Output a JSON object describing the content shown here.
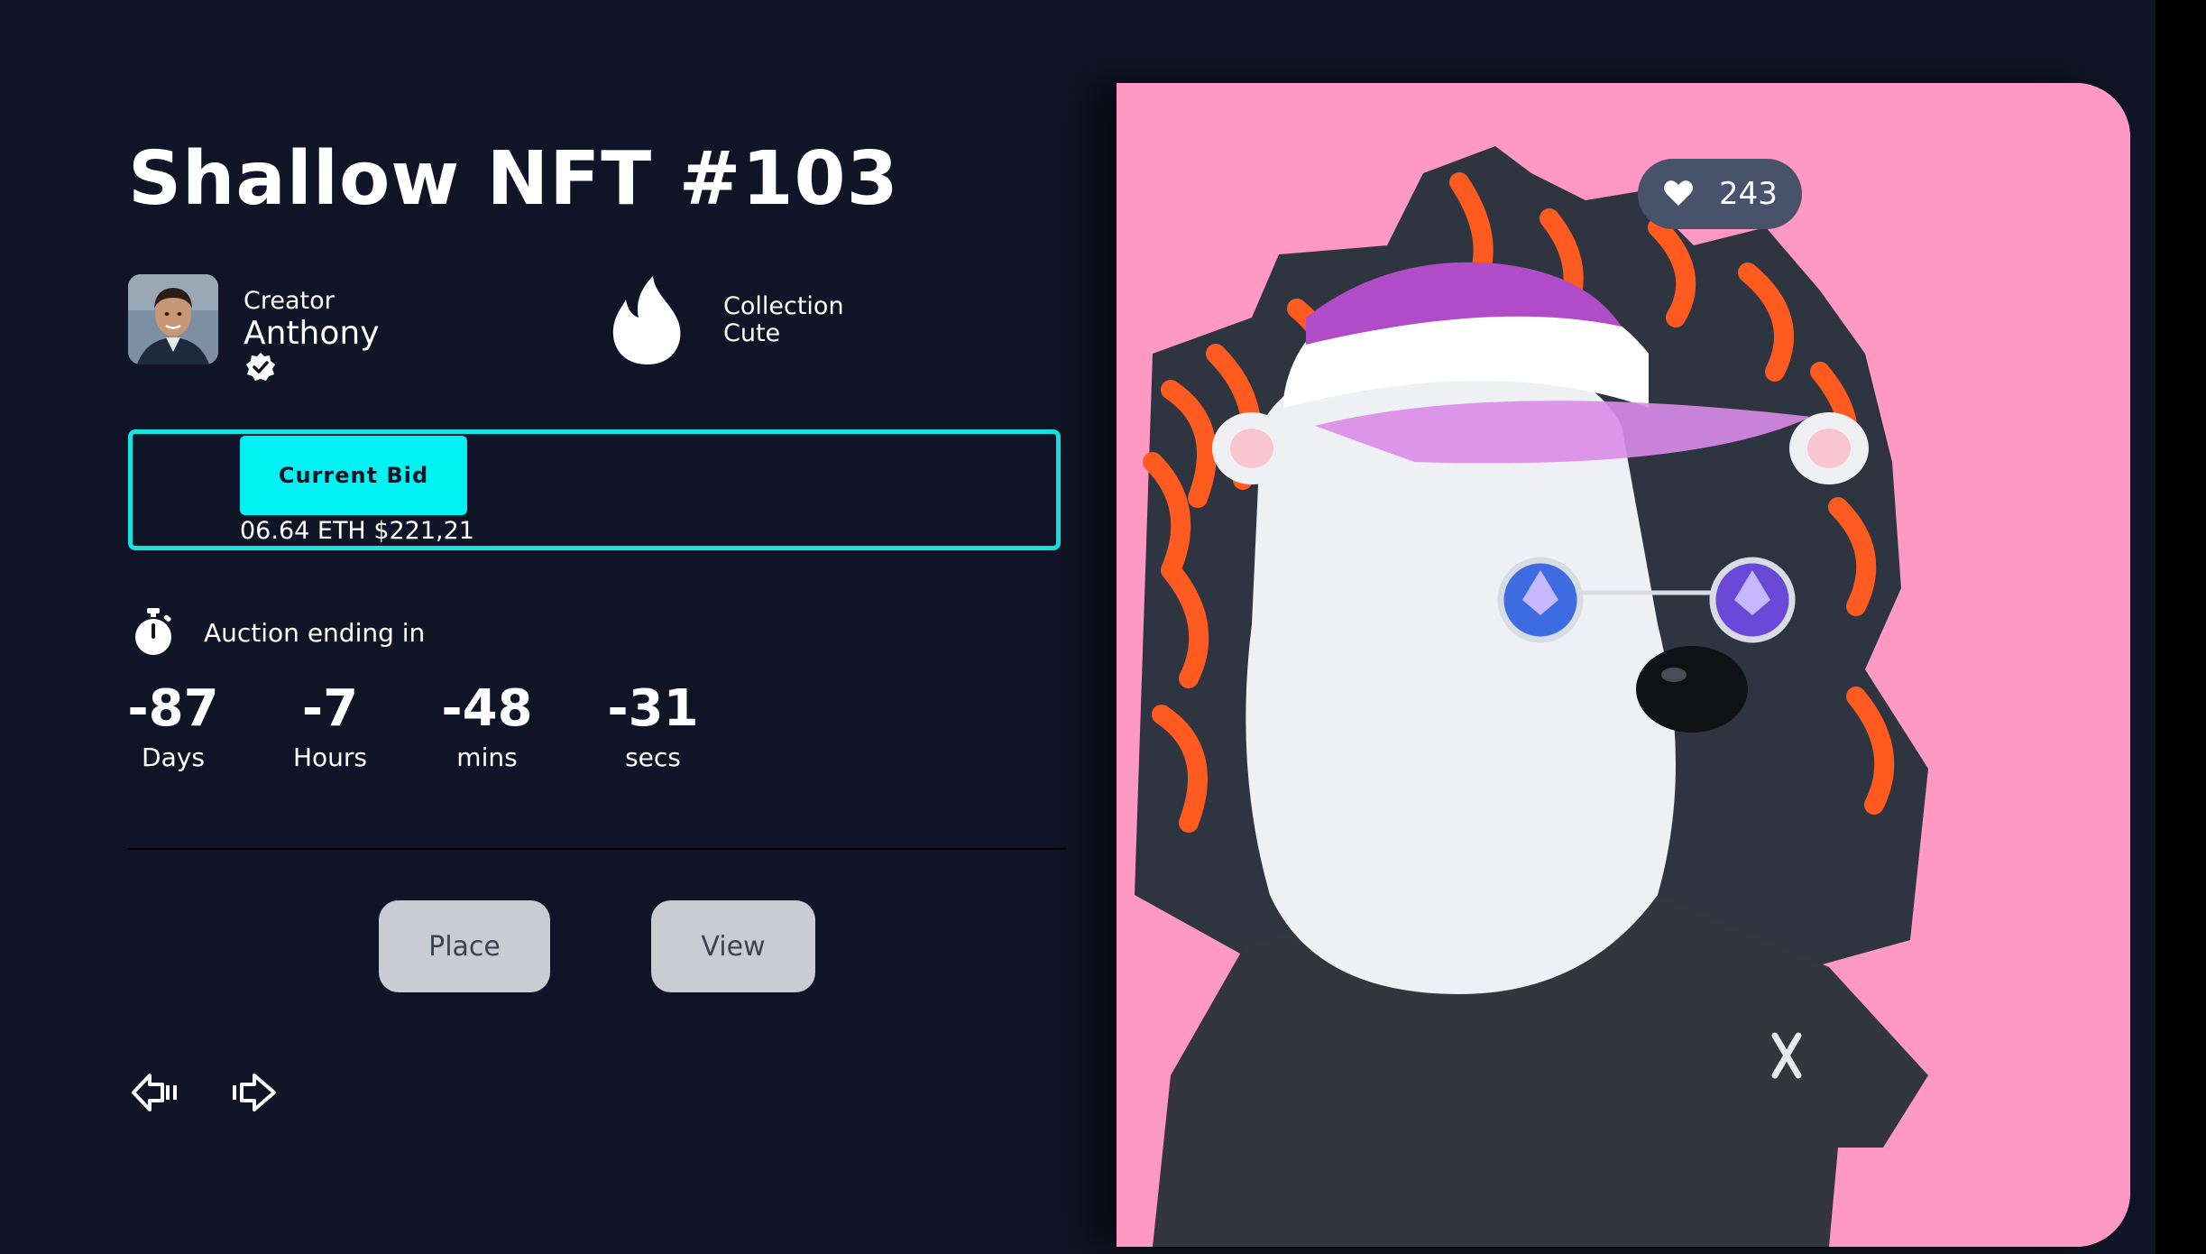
{
  "nft": {
    "title": "Shallow NFT #103"
  },
  "creator": {
    "label": "Creator",
    "name": "Anthony"
  },
  "collection": {
    "label": "Collection",
    "value": "Cute"
  },
  "bid": {
    "label": "Current Bid",
    "value": "06.64 ETH $221,21"
  },
  "auction": {
    "label": "Auction ending in",
    "countdown": [
      {
        "value": "-87",
        "unit": "Days"
      },
      {
        "value": "-7",
        "unit": "Hours"
      },
      {
        "value": "-48",
        "unit": "mins"
      },
      {
        "value": "-31",
        "unit": "secs"
      }
    ]
  },
  "actions": {
    "place_label": "Place",
    "view_label": "View"
  },
  "navigation": {
    "prev_icon": "arrow-left-icon",
    "next_icon": "arrow-right-icon"
  },
  "artwork": {
    "likes": "243",
    "background_color": "#ff99c4",
    "shirt_logo": "X"
  },
  "colors": {
    "background": "#0f1526",
    "accent": "#00f3f3",
    "button": "#c9ccd3"
  }
}
